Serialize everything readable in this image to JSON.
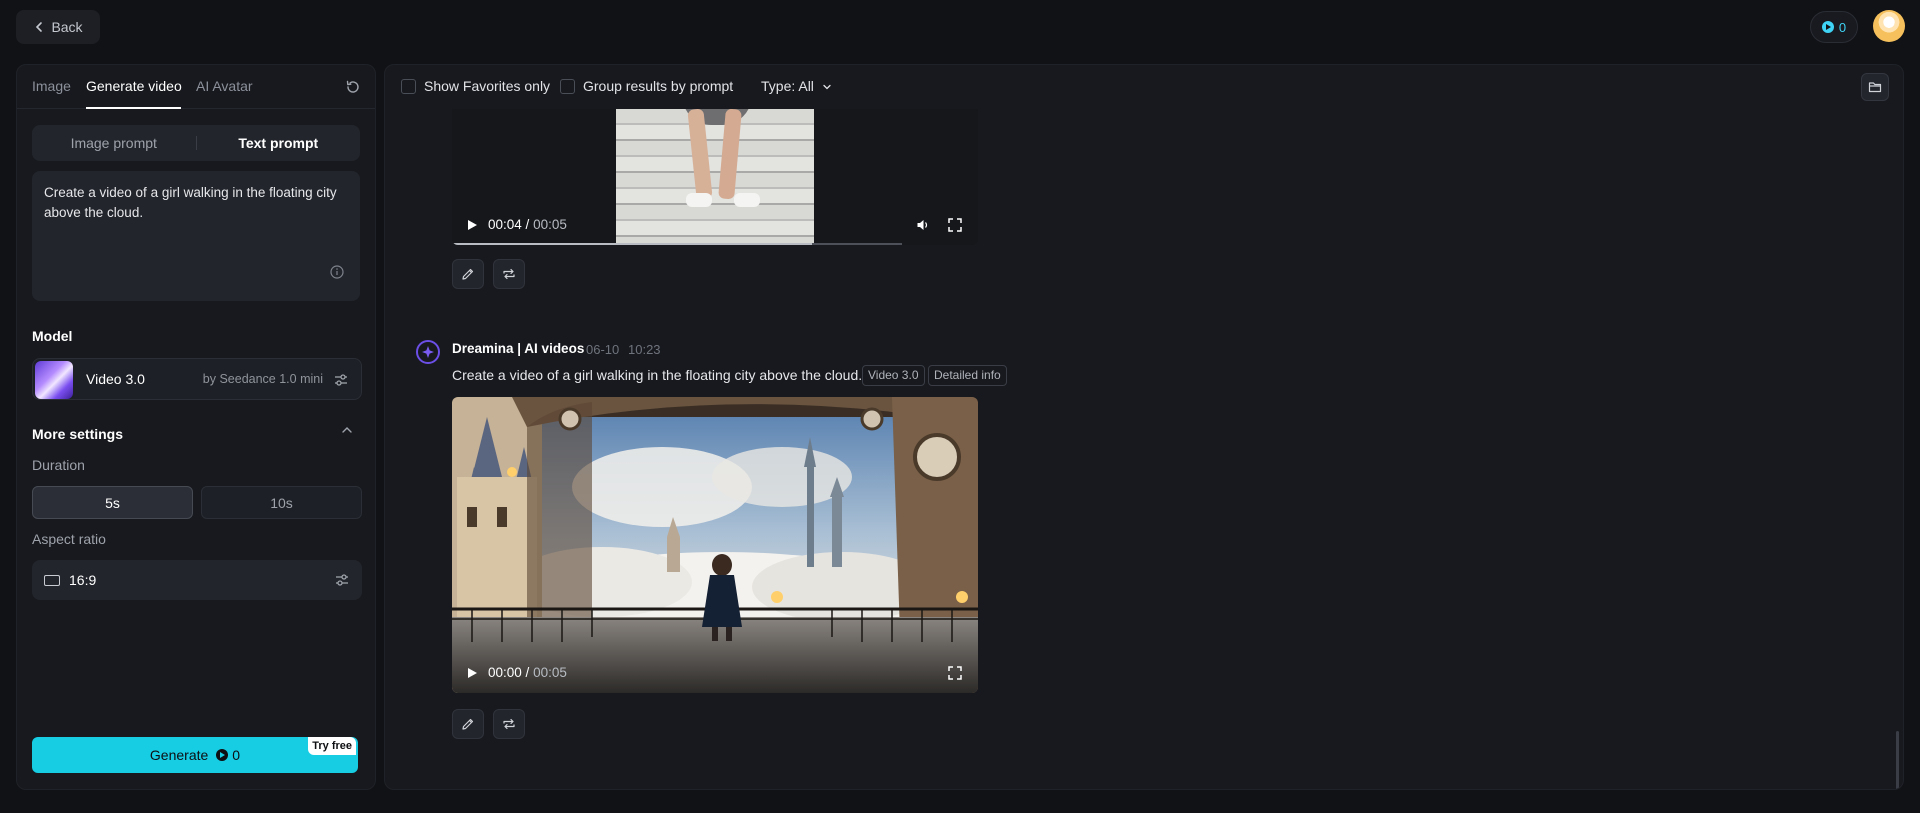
{
  "topbar": {
    "back_label": "Back",
    "credits": "0"
  },
  "left": {
    "tabs": [
      {
        "label": "Image"
      },
      {
        "label": "Generate video"
      },
      {
        "label": "AI Avatar"
      }
    ],
    "prompt_modes": {
      "image": "Image prompt",
      "text": "Text prompt"
    },
    "prompt_text": "Create a video of a girl walking in the floating city above the cloud.",
    "model_section": "Model",
    "model": {
      "name": "Video 3.0",
      "by": "by Seedance 1.0 mini"
    },
    "more_settings": "More settings",
    "duration_label": "Duration",
    "durations": [
      "5s",
      "10s"
    ],
    "selected_duration": "5s",
    "aspect_label": "Aspect ratio",
    "aspect_value": "16:9",
    "generate": {
      "label": "Generate",
      "credits": "0",
      "badge": "Try free"
    }
  },
  "filters": {
    "favorites": "Show Favorites only",
    "group": "Group results by prompt",
    "type": "Type: All"
  },
  "feed": {
    "item1": {
      "time_current": "00:04",
      "time_total": "00:05",
      "progress": 0.8
    },
    "item2": {
      "bot_name": "Dreamina | AI videos",
      "date": "06-10",
      "time": "10:23",
      "prompt": "Create a video of a girl walking in the floating city above the cloud.",
      "tags": [
        "Video 3.0",
        "Detailed info"
      ],
      "time_current": "00:00",
      "time_total": "00:05"
    }
  },
  "colors": {
    "accent": "#16cde4",
    "background": "#111216",
    "panel": "#17191e",
    "bot_ring": "#6b4fe6"
  }
}
